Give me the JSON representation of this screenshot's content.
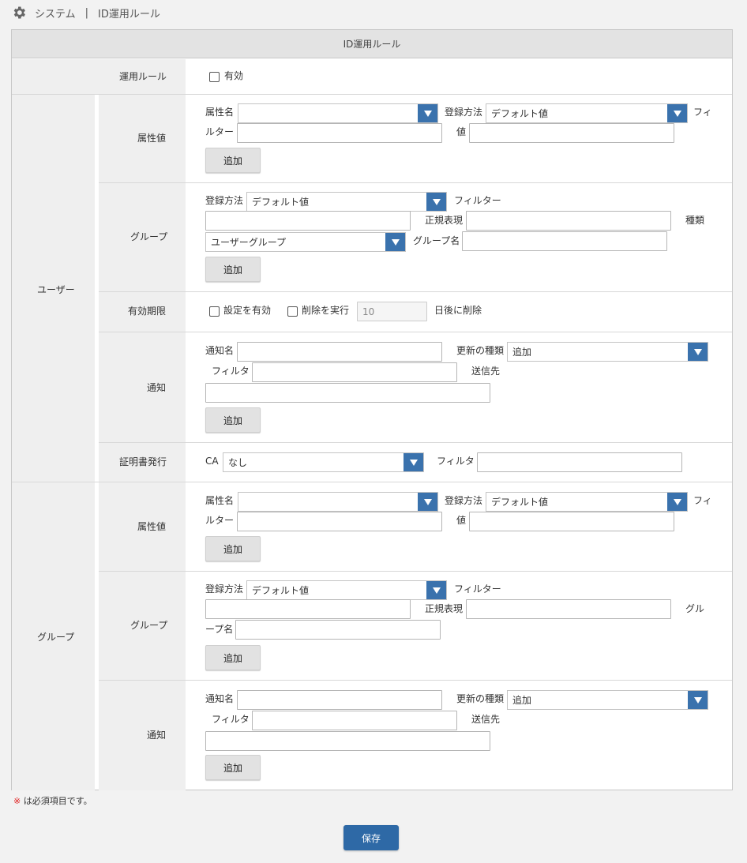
{
  "breadcrumb": {
    "system": "システム",
    "separator": "|",
    "page": "ID運用ルール"
  },
  "panel": {
    "title": "ID運用ルール"
  },
  "rule": {
    "label": "運用ルール",
    "enabled_label": "有効"
  },
  "labels": {
    "attr_name": "属性名",
    "reg_method": "登録方法",
    "filter_a": "フィ",
    "filter_b": "ルター",
    "value": "値",
    "add": "追加",
    "filter_full": "フィルター",
    "regex": "正規表現",
    "type": "種類",
    "group_name": "グループ名",
    "group_name_a": "グル",
    "group_name_b": "ープ名",
    "notify_name": "通知名",
    "update_type": "更新の種類",
    "filter_short": "フィルタ",
    "recipient": "送信先",
    "ca": "CA",
    "set_enabled": "設定を有効",
    "do_delete": "削除を実行",
    "days_after": "日後に削除"
  },
  "selects": {
    "default_value": "デフォルト値",
    "user_group": "ユーザーグループ",
    "update_add": "追加",
    "ca_none": "なし",
    "days": "10"
  },
  "categories": {
    "user": "ユーザー",
    "group": "グループ"
  },
  "sections": {
    "attr": "属性値",
    "group": "グループ",
    "expiry": "有効期限",
    "notify": "通知",
    "cert": "証明書発行"
  },
  "footer": {
    "required_mark": "※",
    "required_text": "は必須項目です。",
    "save": "保存"
  },
  "colors": {
    "accent": "#3a72ad",
    "save": "#2e69a6",
    "required": "#e02020"
  }
}
